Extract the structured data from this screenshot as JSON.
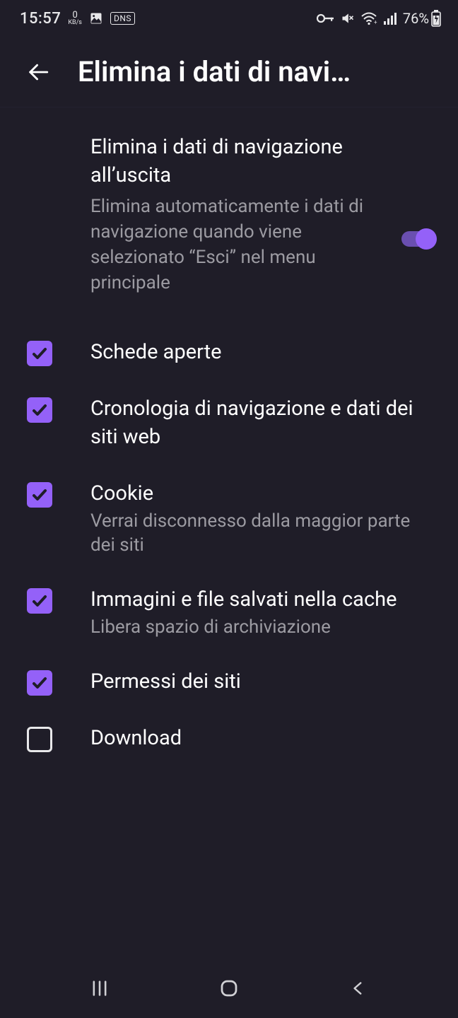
{
  "status": {
    "time": "15:57",
    "kbs_value": "0",
    "kbs_unit": "KB/s",
    "dns_label": "DNS",
    "battery_pct": "76%"
  },
  "header": {
    "title": "Elimina i dati di navi…"
  },
  "master": {
    "title": "Elimina i dati di navigazione all’uscita",
    "subtitle": "Elimina automaticamente i dati di navigazione quando viene selezionato “Esci” nel menu principale",
    "enabled": true
  },
  "options": [
    {
      "id": "open-tabs",
      "title": "Schede aperte",
      "subtitle": "",
      "checked": true
    },
    {
      "id": "history",
      "title": "Cronologia di navigazione e dati dei siti web",
      "subtitle": "",
      "checked": true
    },
    {
      "id": "cookies",
      "title": "Cookie",
      "subtitle": "Verrai disconnesso dalla maggior parte dei siti",
      "checked": true
    },
    {
      "id": "cache",
      "title": "Immagini e file salvati nella cache",
      "subtitle": "Libera spazio di archiviazione",
      "checked": true
    },
    {
      "id": "site-perms",
      "title": "Permessi dei siti",
      "subtitle": "",
      "checked": true
    },
    {
      "id": "downloads",
      "title": "Download",
      "subtitle": "",
      "checked": false
    }
  ],
  "colors": {
    "accent": "#9461f8",
    "bg": "#1f1d28",
    "text_secondary": "#9c9ba2"
  }
}
